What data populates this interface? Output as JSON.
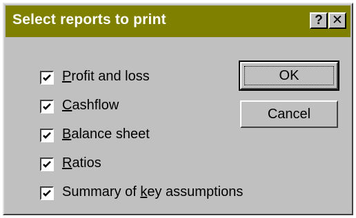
{
  "dialog": {
    "title": "Select reports to print",
    "help_button": "?",
    "close_button": "✕"
  },
  "reports": [
    {
      "label_before": "",
      "accel": "P",
      "label_after": "rofit and loss",
      "checked": true
    },
    {
      "label_before": "",
      "accel": "C",
      "label_after": "ashflow",
      "checked": true
    },
    {
      "label_before": "",
      "accel": "B",
      "label_after": "alance sheet",
      "checked": true
    },
    {
      "label_before": "",
      "accel": "R",
      "label_after": "atios",
      "checked": true
    },
    {
      "label_before": "Summary of ",
      "accel": "k",
      "label_after": "ey assumptions",
      "checked": true
    }
  ],
  "buttons": {
    "ok": "OK",
    "cancel": "Cancel"
  },
  "colors": {
    "titlebar": "#808000",
    "face": "#c0c0c0"
  }
}
